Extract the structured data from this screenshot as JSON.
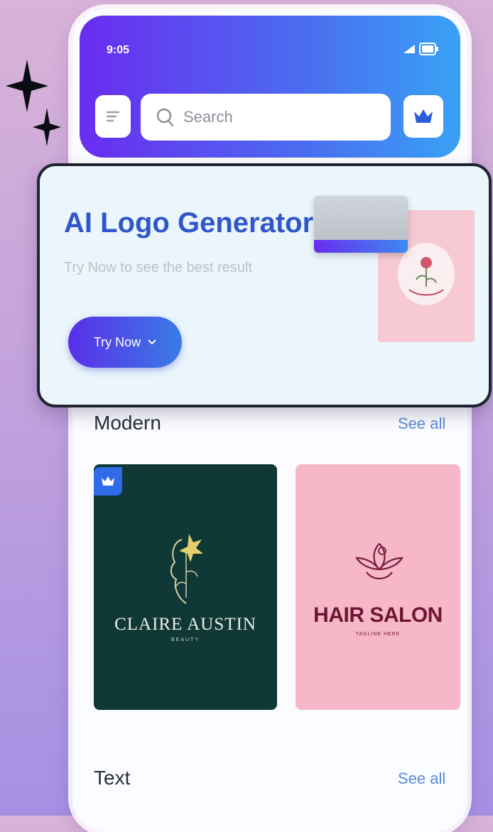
{
  "status_bar": {
    "time": "9:05"
  },
  "search": {
    "placeholder": "Search"
  },
  "promo": {
    "title": "AI Logo Generator",
    "subtitle": "Try Now to see the best result",
    "button_label": "Try Now"
  },
  "sections": [
    {
      "title": "Modern",
      "see_all": "See all",
      "cards": [
        {
          "name": "CLAIRE AUSTIN",
          "tagline": "BEAUTY",
          "premium": true
        },
        {
          "name": "HAIR SALON",
          "tagline": "TAGLINE HERE",
          "premium": false
        }
      ]
    },
    {
      "title": "Text",
      "see_all": "See all"
    }
  ],
  "colors": {
    "accent_purple": "#6a2cf0",
    "accent_blue": "#38a2f5",
    "promo_title": "#3156c9",
    "link": "#5b8bd8",
    "card_dark_green": "#0f3836",
    "card_pink": "#f6b8c8"
  },
  "icons": [
    "sparkle-icon",
    "signal-icon",
    "battery-icon",
    "menu-icon",
    "search-icon",
    "crown-icon",
    "chevron-down-icon"
  ]
}
